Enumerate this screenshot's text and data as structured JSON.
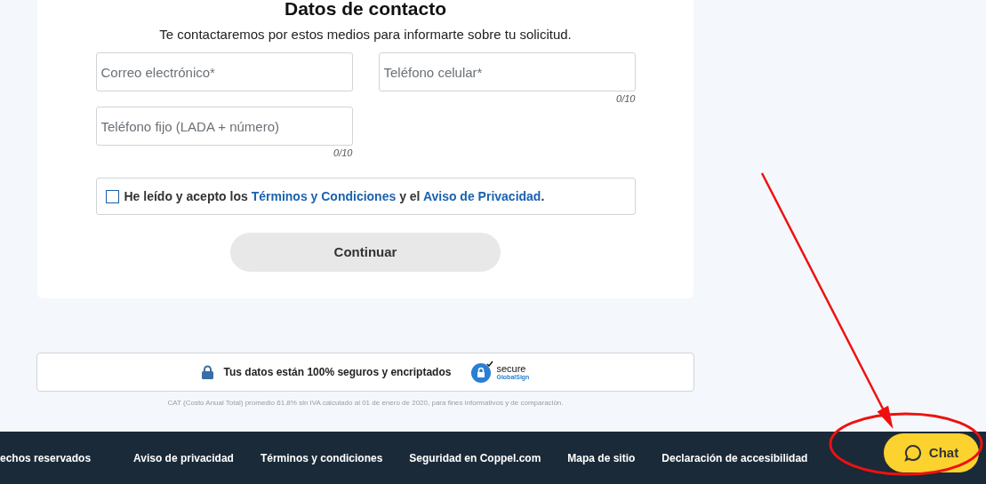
{
  "form": {
    "title": "Datos de contacto",
    "subtitle": "Te contactaremos por estos medios para informarte sobre tu solicitud.",
    "fields": [
      {
        "placeholder": "Correo electrónico*"
      },
      {
        "placeholder": "Teléfono celular*",
        "counter": "0/10"
      },
      {
        "placeholder": "Teléfono fijo (LADA + número)",
        "counter": "0/10"
      }
    ],
    "consent": {
      "checked": false,
      "parts": [
        {
          "kind": "text",
          "text": "He leído y acepto los "
        },
        {
          "kind": "link",
          "text": "Términos y Condiciones"
        },
        {
          "kind": "text",
          "text": " y el "
        },
        {
          "kind": "link",
          "text": "Aviso de Privacidad"
        },
        {
          "kind": "text",
          "text": "."
        }
      ]
    },
    "submit": {
      "label": "Continuar",
      "disabled": true
    }
  },
  "security": {
    "text": "Tus datos están 100% seguros y encriptados",
    "seal_title": "secure",
    "seal_brand": "GlobalSign"
  },
  "disclaimer": "CAT (Costo Anual Total) promedio 61.8% sin IVA calculado al 01 de enero de 2020, para fines informativos y de comparación.",
  "footer": {
    "copyright": "echos reservados",
    "links": [
      "Aviso de privacidad",
      "Términos y condiciones",
      "Seguridad en Coppel.com",
      "Mapa de sitio",
      "Declaración de accesibilidad"
    ]
  },
  "chat": {
    "label": "Chat"
  }
}
